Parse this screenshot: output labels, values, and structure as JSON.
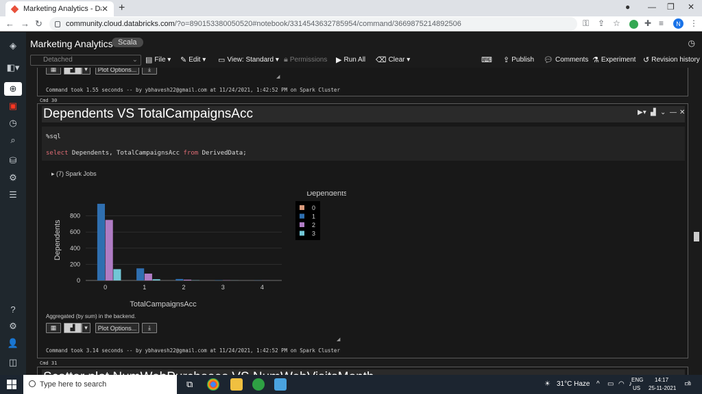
{
  "browser": {
    "tab_title": "Marketing Analytics - Databricks",
    "url_domain": "community.cloud.databricks.com",
    "url_path": "/?o=890153380050520#notebook/3314543632785954/command/3669875214892506",
    "profile_initial": "N"
  },
  "notebook": {
    "title": "Marketing Analytics",
    "language": "Scala",
    "cluster": "Detached",
    "menu": {
      "file": "File",
      "edit": "Edit",
      "view": "View: Standard",
      "permissions": "Permissions",
      "run_all": "Run All",
      "clear": "Clear",
      "publish": "Publish",
      "comments": "Comments",
      "experiment": "Experiment",
      "revision_history": "Revision history"
    }
  },
  "prev_cell": {
    "plot_options": "Plot Options...",
    "took": "Command took 1.55 seconds -- by ybhavesh22@gmail.com at 11/24/2021, 1:42:52 PM on Spark Cluster"
  },
  "cell": {
    "cmd_label": "Cmd 30",
    "title": "Dependents VS TotalCampaignsAcc",
    "code_line1": "%sql",
    "code_kw1": "select",
    "code_mid": " Dependents, TotalCampaignsAcc ",
    "code_kw2": "from",
    "code_end": " DerivedData;",
    "spark_jobs": "(7) Spark Jobs",
    "aggregated": "Aggregated (by sum) in the backend.",
    "plot_options": "Plot Options...",
    "took": "Command took 3.14 seconds -- by ybhavesh22@gmail.com at 11/24/2021, 1:42:52 PM on Spark Cluster"
  },
  "next_cell": {
    "cmd_label": "Cmd 31",
    "title": "Scatter plot NumWebPurchases VS NumWebVisitsMonth"
  },
  "chart_data": {
    "type": "bar",
    "title": "",
    "xlabel": "TotalCampaignsAcc",
    "ylabel": "Dependents",
    "legend_title": "Dependents",
    "legend_position": "top-right",
    "categories": [
      "0",
      "1",
      "2",
      "3",
      "4"
    ],
    "ylim": [
      0,
      1000
    ],
    "yticks": [
      0,
      200,
      400,
      600,
      800
    ],
    "series": [
      {
        "name": "0",
        "color": "#d99a7c",
        "values": [
          0,
          0,
          0,
          0,
          0
        ]
      },
      {
        "name": "1",
        "color": "#2f6fb0",
        "values": [
          950,
          150,
          18,
          4,
          2
        ]
      },
      {
        "name": "2",
        "color": "#b07cc4",
        "values": [
          750,
          85,
          10,
          3,
          1
        ]
      },
      {
        "name": "3",
        "color": "#72c7d6",
        "values": [
          140,
          15,
          3,
          1,
          0
        ]
      }
    ]
  },
  "taskbar": {
    "search_placeholder": "Type here to search",
    "weather": "31°C  Haze",
    "lang_line1": "ENG",
    "lang_line2": "US",
    "time": "14:17",
    "date": "25-11-2021",
    "notif_count": "2"
  }
}
